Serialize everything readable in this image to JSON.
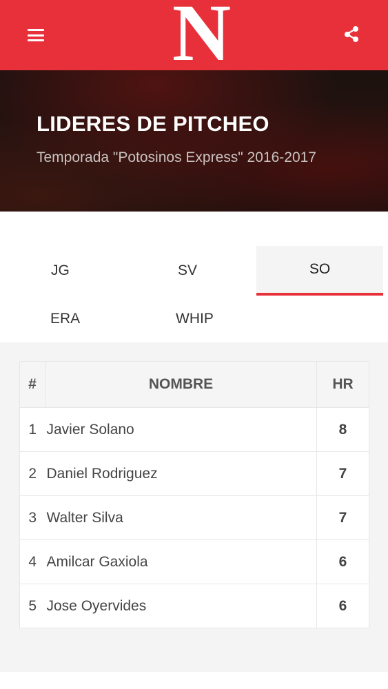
{
  "header": {
    "logo": "N",
    "menu_icon": "menu-icon",
    "share_icon": "share-icon",
    "brand_color": "#e8303a"
  },
  "hero": {
    "title": "LIDERES DE PITCHEO",
    "subtitle": "Temporada \"Potosinos Express\" 2016-2017"
  },
  "tabs": [
    {
      "label": "JG",
      "active": false
    },
    {
      "label": "SV",
      "active": false
    },
    {
      "label": "SO",
      "active": true
    },
    {
      "label": "ERA",
      "active": false
    },
    {
      "label": "WHIP",
      "active": false
    }
  ],
  "table": {
    "headers": [
      "#",
      "NOMBRE",
      "HR"
    ],
    "rows": [
      {
        "rank": "1",
        "name": "Javier Solano",
        "value": "8"
      },
      {
        "rank": "2",
        "name": "Daniel Rodriguez",
        "value": "7"
      },
      {
        "rank": "3",
        "name": "Walter Silva",
        "value": "7"
      },
      {
        "rank": "4",
        "name": "Amilcar Gaxiola",
        "value": "6"
      },
      {
        "rank": "5",
        "name": "Jose Oyervides",
        "value": "6"
      }
    ]
  }
}
